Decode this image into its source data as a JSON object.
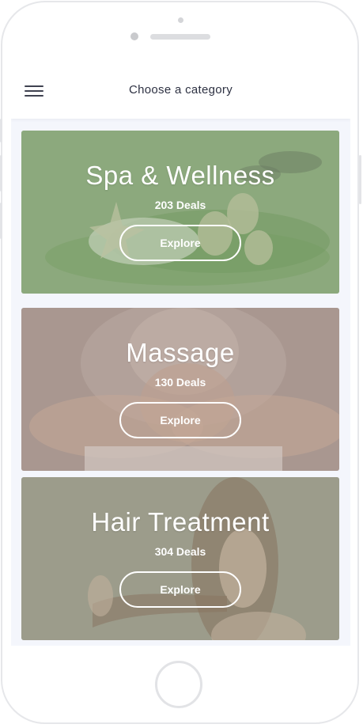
{
  "header": {
    "title": "Choose a category",
    "menu_icon": "hamburger-menu-icon"
  },
  "categories": [
    {
      "title": "Spa & Wellness",
      "deals": "203 Deals",
      "button": "Explore",
      "tint": "#8aa67b",
      "image": "spa stones, towel, starfish and leaves"
    },
    {
      "title": "Massage",
      "deals": "130 Deals",
      "button": "Explore",
      "tint": "#a8958f",
      "image": "woman relaxing on massage table"
    },
    {
      "title": "Hair Treatment",
      "deals": "304 Deals",
      "button": "Explore",
      "tint": "#9c9c8a",
      "image": "woman with long hair"
    }
  ],
  "colors": {
    "screen_background": "#f4f6fc",
    "title_text": "#2d3142",
    "card_text": "#ffffff"
  }
}
